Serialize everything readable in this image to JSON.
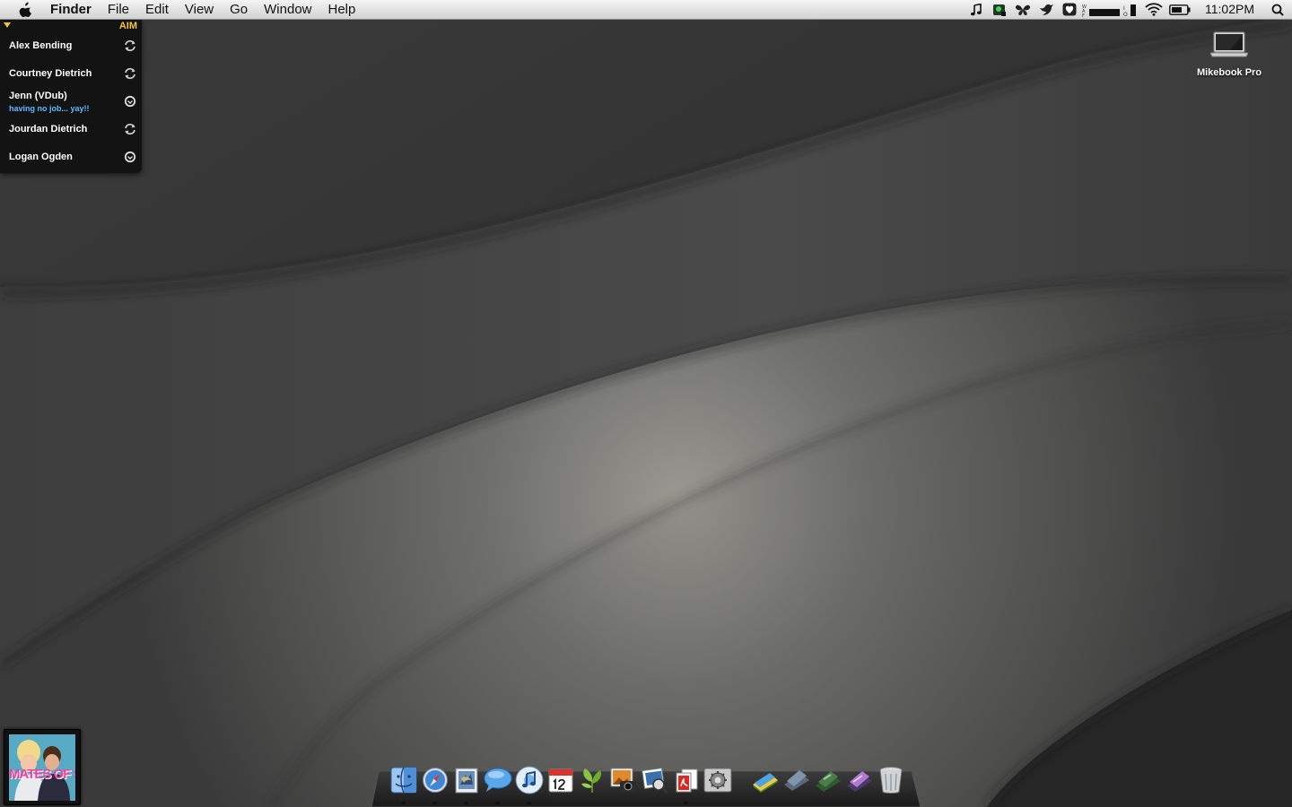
{
  "menubar": {
    "app_name": "Finder",
    "menus": [
      "File",
      "Edit",
      "View",
      "Go",
      "Window",
      "Help"
    ],
    "status_icons": [
      "itunes-note-icon",
      "growl-icon",
      "butterfly-icon",
      "bird-icon",
      "heart-icon",
      "memory-meter-icon",
      "cpu-meter-icon",
      "wifi-icon",
      "battery-icon"
    ],
    "clock": "11:02PM"
  },
  "aim": {
    "title": "AIM",
    "buddies": [
      {
        "name": "Alex Bending",
        "status": "",
        "state": "idle"
      },
      {
        "name": "Courtney Dietrich",
        "status": "",
        "state": "idle"
      },
      {
        "name": "Jenn (VDub)",
        "status": "having no job... yay!!",
        "state": "online"
      },
      {
        "name": "Jourdan Dietrich",
        "status": "",
        "state": "idle"
      },
      {
        "name": "Logan Ogden",
        "status": "",
        "state": "online"
      }
    ],
    "colors": {
      "title": "#f5c534",
      "status": "#5fb8ff"
    }
  },
  "desktop": {
    "items": [
      {
        "label": "Mikebook Pro",
        "icon": "laptop-icon"
      }
    ]
  },
  "album": {
    "art_text": "MATES OF STATE"
  },
  "dock": {
    "apps": [
      "finder-icon",
      "safari-icon",
      "mail-icon",
      "ichat-icon",
      "itunes-icon",
      "ical-icon",
      "leaf-icon",
      "iphoto-icon",
      "preview-icon",
      "pdf-icon",
      "system-preferences-icon"
    ],
    "stacks": [
      "documents-stack-icon",
      "applications-stack-icon",
      "downloads-stack-icon",
      "pictures-stack-icon",
      "trash-icon"
    ],
    "running": [
      "finder-icon",
      "safari-icon",
      "mail-icon",
      "ichat-icon",
      "itunes-icon",
      "pdf-icon"
    ]
  }
}
